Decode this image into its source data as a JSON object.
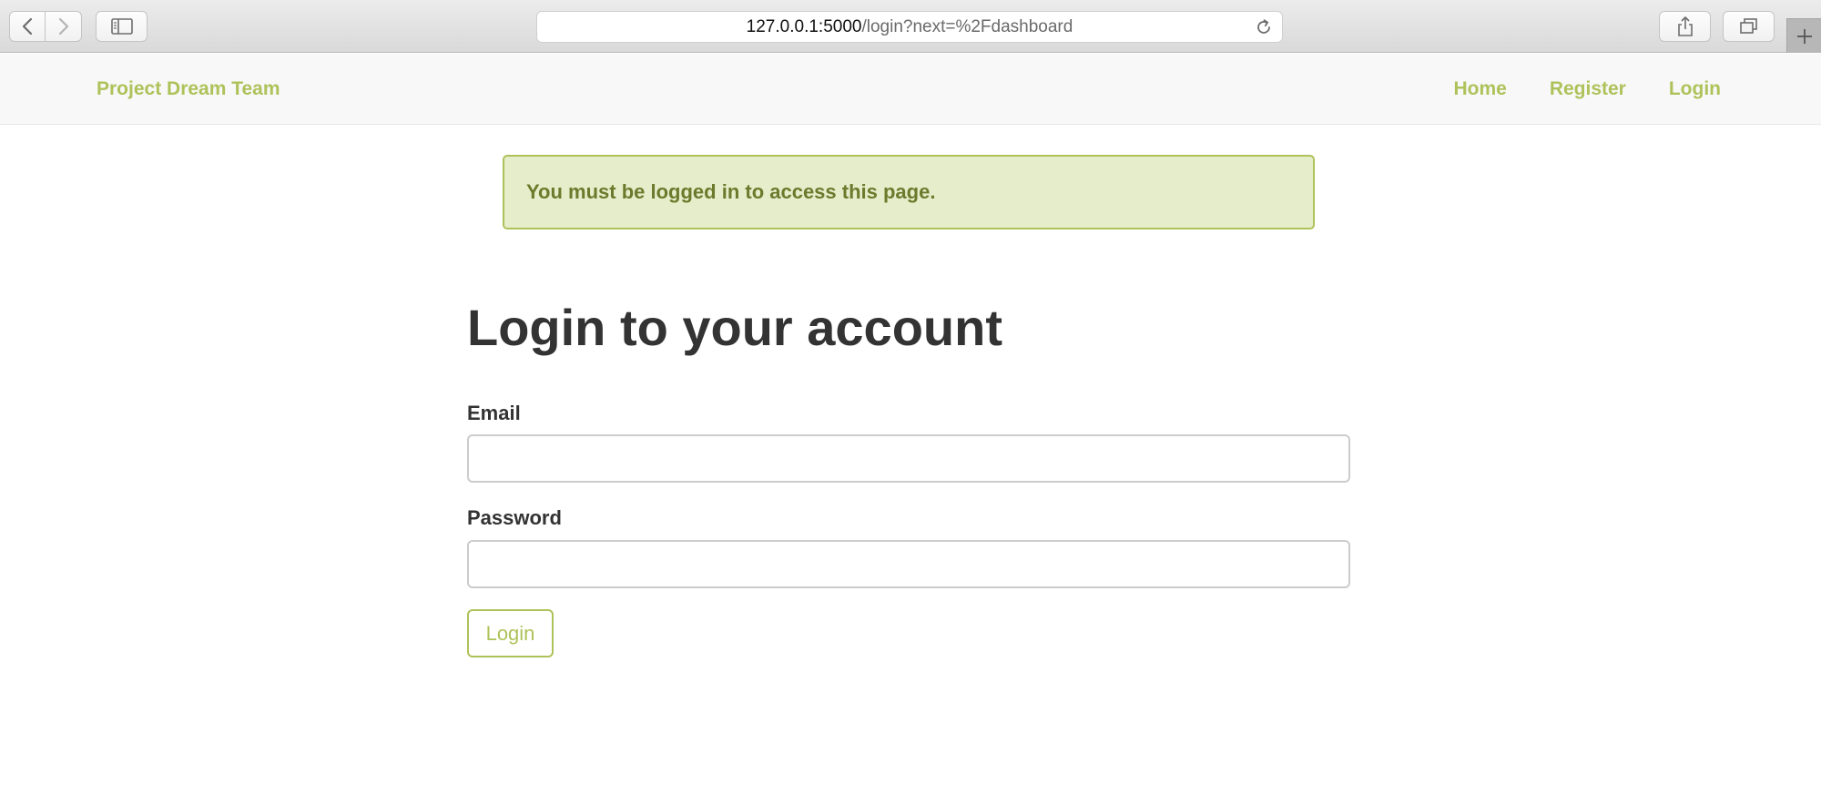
{
  "browser": {
    "url_host": "127.0.0.1:5000",
    "url_path": "/login?next=%2Fdashboard",
    "icons": {
      "back": "chevron-left-icon",
      "forward": "chevron-right-icon",
      "sidebar": "sidebar-icon",
      "reload": "reload-icon",
      "share": "share-icon",
      "tabs": "tabs-overview-icon",
      "new_tab": "plus-icon"
    }
  },
  "navbar": {
    "brand": "Project Dream Team",
    "links": [
      "Home",
      "Register",
      "Login"
    ]
  },
  "alert": {
    "message": "You must be logged in to access this page."
  },
  "form": {
    "title": "Login to your account",
    "email_label": "Email",
    "email_value": "",
    "password_label": "Password",
    "password_value": "",
    "submit_label": "Login"
  },
  "colors": {
    "accent": "#aec25a",
    "alert_background": "#e6edca",
    "alert_text": "#6b7a2c",
    "heading_text": "#333333"
  }
}
